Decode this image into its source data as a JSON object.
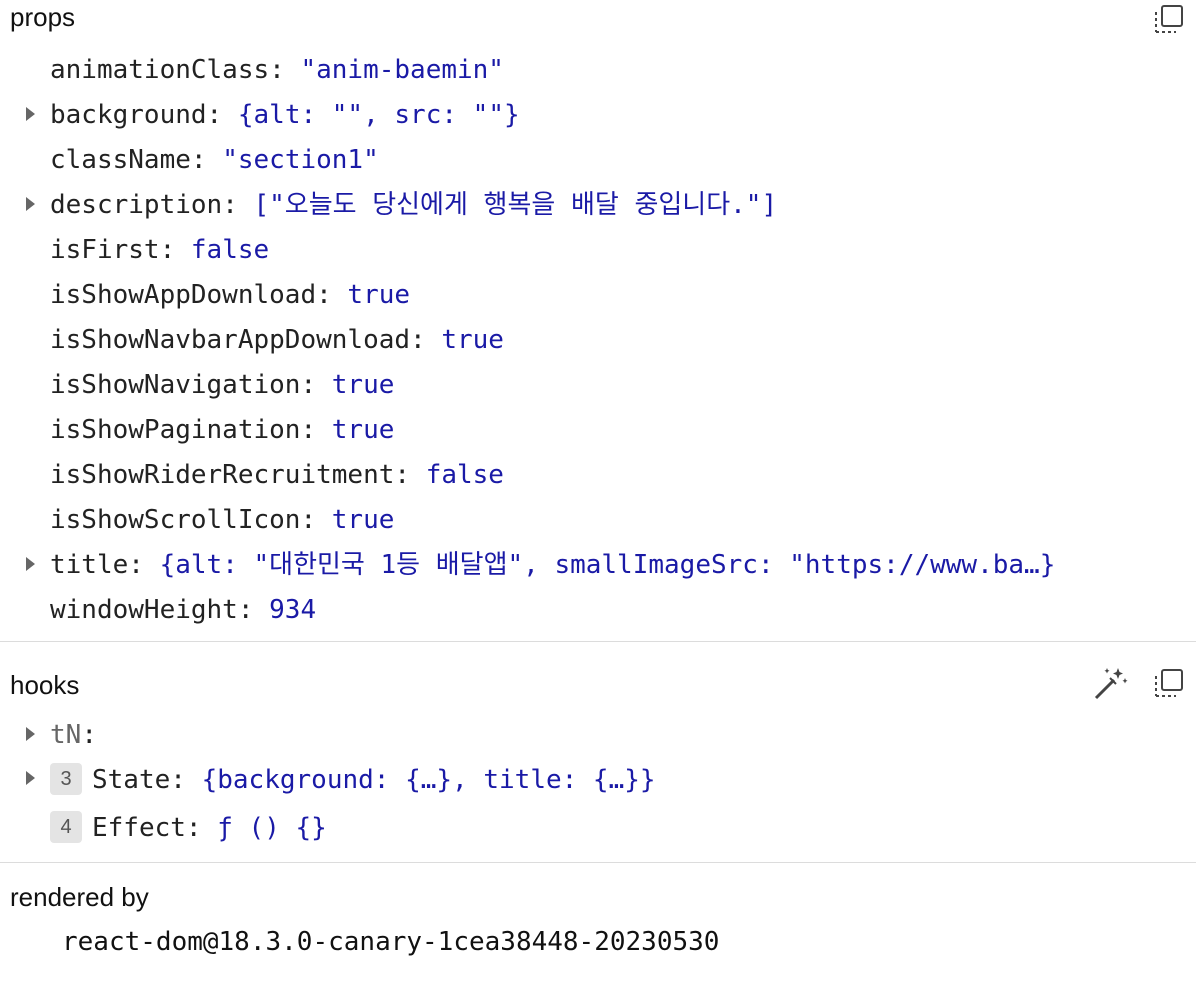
{
  "props": {
    "title": "props",
    "items": [
      {
        "key": "animationClass",
        "value": "\"anim-baemin\"",
        "expandable": false
      },
      {
        "key": "background",
        "value": "{alt: \"\", src: \"\"}",
        "expandable": true
      },
      {
        "key": "className",
        "value": "\"section1\"",
        "expandable": false
      },
      {
        "key": "description",
        "value": "[\"오늘도 당신에게 행복을 배달 중입니다.\"]",
        "expandable": true
      },
      {
        "key": "isFirst",
        "value": "false",
        "expandable": false
      },
      {
        "key": "isShowAppDownload",
        "value": "true",
        "expandable": false
      },
      {
        "key": "isShowNavbarAppDownload",
        "value": "true",
        "expandable": false
      },
      {
        "key": "isShowNavigation",
        "value": "true",
        "expandable": false
      },
      {
        "key": "isShowPagination",
        "value": "true",
        "expandable": false
      },
      {
        "key": "isShowRiderRecruitment",
        "value": "false",
        "expandable": false
      },
      {
        "key": "isShowScrollIcon",
        "value": "true",
        "expandable": false
      },
      {
        "key": "title",
        "value": "{alt: \"대한민국 1등 배달앱\", smallImageSrc: \"https://www.ba…}",
        "expandable": true
      },
      {
        "key": "windowHeight",
        "value": "934",
        "expandable": false
      }
    ]
  },
  "hooks": {
    "title": "hooks",
    "items": [
      {
        "badge": "",
        "name": "tN",
        "value": "",
        "expandable": true
      },
      {
        "badge": "3",
        "name": "State",
        "value": "{background: {…}, title: {…}}",
        "expandable": true
      },
      {
        "badge": "4",
        "name": "Effect",
        "value": "ƒ () {}",
        "expandable": false
      }
    ]
  },
  "rendered_by": {
    "title": "rendered by",
    "value": "react-dom@18.3.0-canary-1cea38448-20230530"
  },
  "icons": {
    "copy": "copy-icon",
    "magic": "magic-wand-icon"
  }
}
